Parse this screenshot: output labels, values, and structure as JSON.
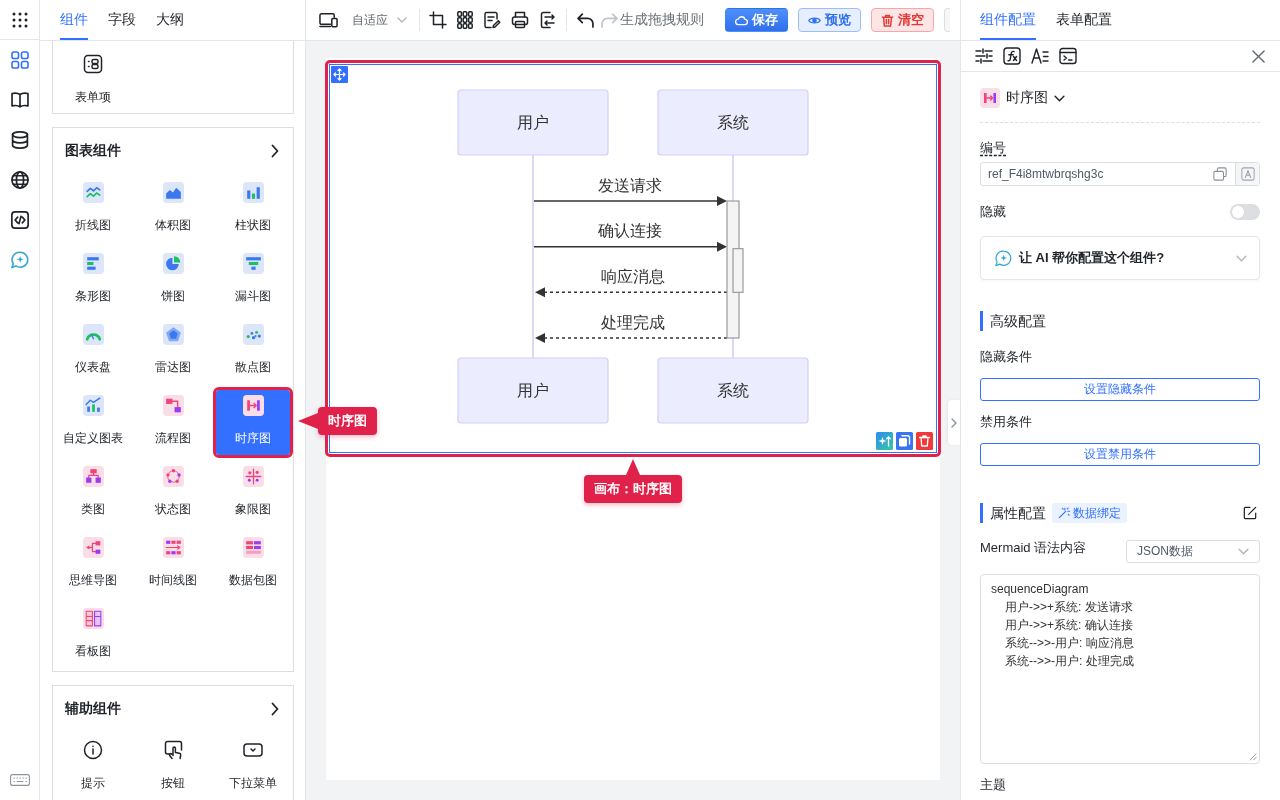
{
  "rail": {
    "items": [
      {
        "selected": true
      },
      {
        "selected": false
      },
      {
        "selected": false
      },
      {
        "selected": false
      },
      {
        "selected": false
      },
      {
        "selected": false
      }
    ]
  },
  "left_panel": {
    "tabs": [
      {
        "label": "组件",
        "selected": true
      },
      {
        "label": "字段",
        "selected": false
      },
      {
        "label": "大纲",
        "selected": false
      }
    ],
    "sections": [
      {
        "items": [
          {
            "label": "表单项",
            "selected": false
          }
        ]
      },
      {
        "title": "图表组件",
        "items": [
          {
            "label": "折线图",
            "selected": false
          },
          {
            "label": "体积图",
            "selected": false
          },
          {
            "label": "柱状图",
            "selected": false
          },
          {
            "label": "条形图",
            "selected": false
          },
          {
            "label": "饼图",
            "selected": false
          },
          {
            "label": "漏斗图",
            "selected": false
          },
          {
            "label": "仪表盘",
            "selected": false
          },
          {
            "label": "雷达图",
            "selected": false
          },
          {
            "label": "散点图",
            "selected": false
          },
          {
            "label": "自定义图表",
            "selected": false
          },
          {
            "label": "流程图",
            "selected": false
          },
          {
            "label": "时序图",
            "selected": true
          },
          {
            "label": "类图",
            "selected": false
          },
          {
            "label": "状态图",
            "selected": false
          },
          {
            "label": "象限图",
            "selected": false
          },
          {
            "label": "思维导图",
            "selected": false
          },
          {
            "label": "时间线图",
            "selected": false
          },
          {
            "label": "数据包图",
            "selected": false
          },
          {
            "label": "看板图",
            "selected": false
          }
        ]
      },
      {
        "title": "辅助组件",
        "items": [
          {
            "label": "提示",
            "selected": false
          },
          {
            "label": "按钮",
            "selected": false
          },
          {
            "label": "下拉菜单",
            "selected": false
          }
        ]
      }
    ]
  },
  "toolbar": {
    "layout_select": "自适应",
    "undo": {
      "disabled": false
    },
    "redo": {
      "disabled": true
    },
    "rule_button": "生成拖拽规则",
    "buttons": [
      {
        "label": "保存",
        "kind": "primary"
      },
      {
        "label": "预览",
        "kind": "secondary"
      },
      {
        "label": "清空",
        "kind": "danger"
      }
    ]
  },
  "canvas": {
    "component": {
      "selected": true,
      "top_participants": [
        "用户",
        "系统"
      ],
      "messages": [
        {
          "text": "发送请求",
          "kind": "request"
        },
        {
          "text": "确认连接",
          "kind": "request"
        },
        {
          "text": "响应消息",
          "kind": "reply"
        },
        {
          "text": "处理完成",
          "kind": "reply"
        }
      ],
      "bottom_participants": [
        "用户",
        "系统"
      ]
    }
  },
  "annotations": [
    {
      "text": "时序图",
      "kind": "left"
    },
    {
      "text": "画布：时序图",
      "kind": "up"
    }
  ],
  "config_panel": {
    "tabs": [
      {
        "label": "组件配置",
        "selected": true
      },
      {
        "label": "表单配置",
        "selected": false
      }
    ],
    "component_type": "时序图",
    "id_field": {
      "label": "编号",
      "value": "ref_F4i8mtwbrqshg3c"
    },
    "hidden": {
      "label": "隐藏",
      "on": false
    },
    "ai_helper": {
      "text": "让 AI 帮你配置这个组件?",
      "expanded": false
    },
    "advanced": {
      "title": "高级配置",
      "conditions": [
        {
          "label": "隐藏条件",
          "button": "设置隐藏条件"
        },
        {
          "label": "禁用条件",
          "button": "设置禁用条件"
        }
      ]
    },
    "properties": {
      "title": "属性配置",
      "binding_tag": "数据绑定",
      "syntax_label": "Mermaid 语法内容",
      "source_select": "JSON数据",
      "code": [
        {
          "text": "sequenceDiagram",
          "children": [
            {
              "text": "用户->>+系统: 发送请求"
            },
            {
              "text": "用户->>+系统: 确认连接"
            },
            {
              "text": "系统-->>-用户: 响应消息"
            },
            {
              "text": "系统-->>-用户: 处理完成"
            }
          ]
        }
      ]
    },
    "theme_label": "主题"
  }
}
